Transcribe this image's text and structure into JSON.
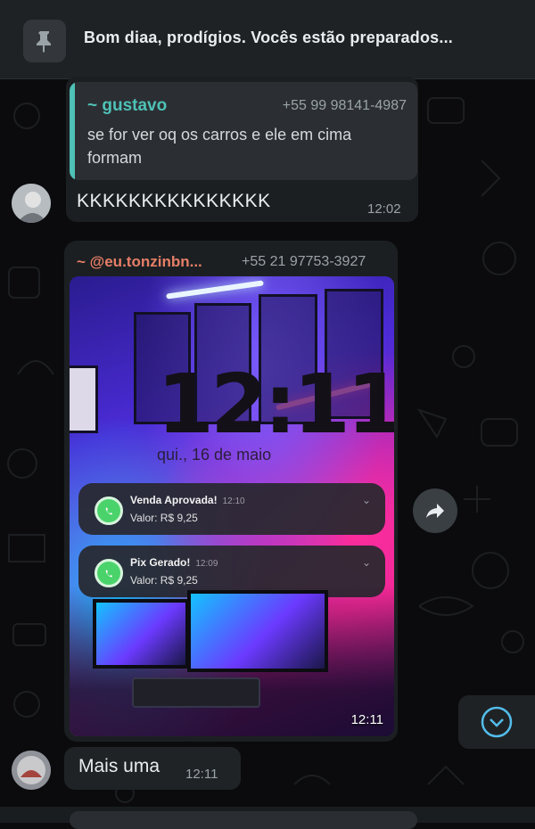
{
  "pinned": {
    "text": "Bom diaa, prodígios. Vocês estão preparados...",
    "icon": "pin-icon"
  },
  "messages": [
    {
      "quote": {
        "name": "~ gustavo",
        "phone": "+55 99 98141-4987",
        "text": "se for ver oq os carros e ele em cima formam"
      },
      "text": "KKKKKKKKKKKKKKK",
      "time": "12:02"
    },
    {
      "sender": "~ @eu.tonzinbn...",
      "phone": "+55 21 97753-3927",
      "image": {
        "clock": "12:11",
        "date": "qui., 16 de maio",
        "notifications": [
          {
            "title": "Venda Aprovada!",
            "time": "12:10",
            "value": "Valor: R$ 9,25"
          },
          {
            "title": "Pix Gerado!",
            "time": "12:09",
            "value": "Valor: R$ 9,25"
          }
        ]
      },
      "time": "12:11"
    },
    {
      "text": "Mais uma",
      "time": "12:11"
    }
  ],
  "colors": {
    "quote_accent": "#4fc1b6",
    "sender_name": "#e57f67",
    "scroll_icon": "#53bdeb"
  }
}
